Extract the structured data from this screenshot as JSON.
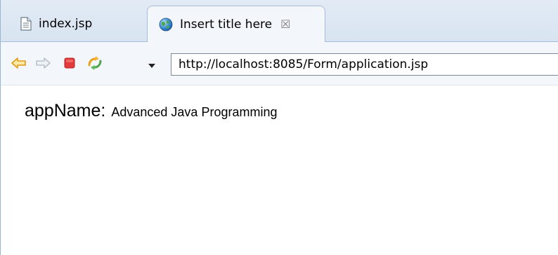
{
  "tabs": [
    {
      "label": "index.jsp",
      "icon": "file-icon",
      "active": false
    },
    {
      "label": "Insert title here",
      "icon": "globe-icon",
      "active": true,
      "close_glyph": "☒"
    }
  ],
  "toolbar": {
    "back_icon": "back-arrow-icon",
    "forward_icon": "forward-arrow-icon",
    "stop_icon": "stop-icon",
    "refresh_icon": "refresh-icon",
    "dropdown_icon": "dropdown-arrow-icon",
    "url": "http://localhost:8085/Form/application.jsp"
  },
  "page": {
    "label": "appName:",
    "value": "Advanced Java Programming"
  },
  "colors": {
    "tab_bar": "#dbe6f2",
    "accent_arrow": "#f0a81c",
    "stop_red": "#e23b3b"
  }
}
